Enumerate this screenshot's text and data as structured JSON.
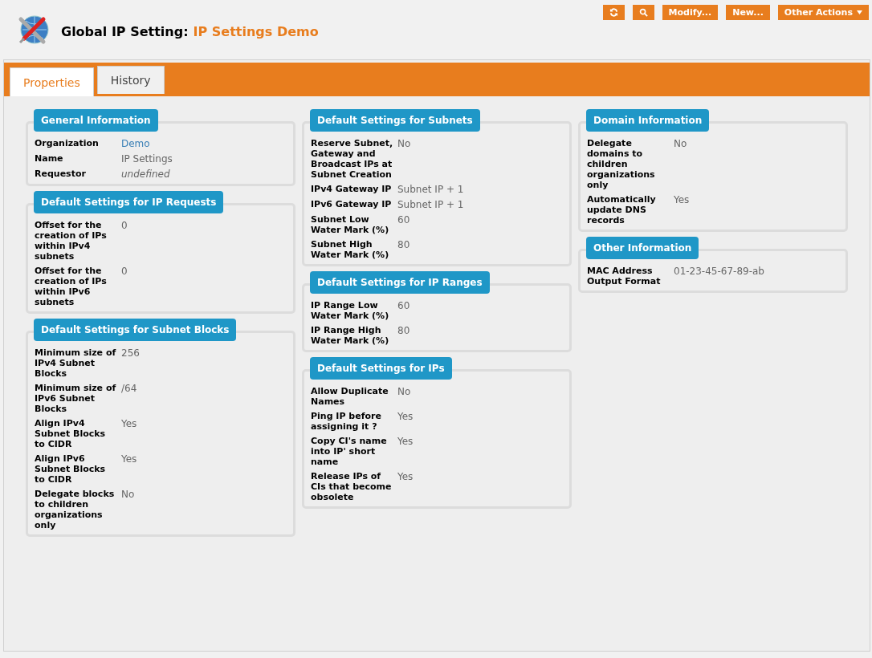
{
  "header": {
    "title": "Global IP Setting:",
    "subtitle": "IP Settings Demo"
  },
  "actions": [
    {
      "kind": "refresh"
    },
    {
      "kind": "search"
    },
    {
      "kind": "text",
      "label": "Modify..."
    },
    {
      "kind": "text",
      "label": "New..."
    },
    {
      "kind": "menu",
      "label": "Other Actions"
    }
  ],
  "tabs": [
    {
      "label": "Properties",
      "selected": true
    },
    {
      "label": "History",
      "selected": false
    }
  ],
  "columns": [
    [
      {
        "title": "General Information",
        "rows": [
          {
            "label": "Organization",
            "value": "Demo",
            "kind": "link"
          },
          {
            "label": "Name",
            "value": "IP Settings",
            "kind": "text"
          },
          {
            "label": "Requestor",
            "value": "undefined",
            "kind": "italic"
          }
        ]
      },
      {
        "title": "Default Settings for IP Requests",
        "rows": [
          {
            "label": "Offset for the creation of IPs within IPv4 subnets",
            "value": "0",
            "kind": "text"
          },
          {
            "label": "Offset for the creation of IPs within IPv6 subnets",
            "value": "0",
            "kind": "text"
          }
        ]
      },
      {
        "title": "Default Settings for Subnet Blocks",
        "rows": [
          {
            "label": "Minimum size of IPv4 Subnet Blocks",
            "value": "256",
            "kind": "text"
          },
          {
            "label": "Minimum size of IPv6 Subnet Blocks",
            "value": "/64",
            "kind": "text"
          },
          {
            "label": "Align IPv4 Subnet Blocks to CIDR",
            "value": "Yes",
            "kind": "text"
          },
          {
            "label": "Align IPv6 Subnet Blocks to CIDR",
            "value": "Yes",
            "kind": "text"
          },
          {
            "label": "Delegate blocks to children organizations only",
            "value": "No",
            "kind": "text"
          }
        ]
      }
    ],
    [
      {
        "title": "Default Settings for Subnets",
        "rows": [
          {
            "label": "Reserve Subnet, Gateway and Broadcast IPs at Subnet Creation",
            "value": "No",
            "kind": "text"
          },
          {
            "label": "IPv4 Gateway IP",
            "value": "Subnet IP + 1",
            "kind": "text"
          },
          {
            "label": "IPv6 Gateway IP",
            "value": "Subnet IP + 1",
            "kind": "text"
          },
          {
            "label": "Subnet Low Water Mark (%)",
            "value": "60",
            "kind": "text"
          },
          {
            "label": "Subnet High Water Mark (%)",
            "value": "80",
            "kind": "text"
          }
        ]
      },
      {
        "title": "Default Settings for IP Ranges",
        "rows": [
          {
            "label": "IP Range Low Water Mark (%)",
            "value": "60",
            "kind": "text"
          },
          {
            "label": "IP Range High Water Mark (%)",
            "value": "80",
            "kind": "text"
          }
        ]
      },
      {
        "title": "Default Settings for IPs",
        "rows": [
          {
            "label": "Allow Duplicate Names",
            "value": "No",
            "kind": "text"
          },
          {
            "label": "Ping IP before assigning it ?",
            "value": "Yes",
            "kind": "text"
          },
          {
            "label": "Copy CI's name into IP' short name",
            "value": "Yes",
            "kind": "text"
          },
          {
            "label": "Release IPs of CIs that become obsolete",
            "value": "Yes",
            "kind": "text"
          }
        ]
      }
    ],
    [
      {
        "title": "Domain Information",
        "rows": [
          {
            "label": "Delegate domains to children organizations only",
            "value": "No",
            "kind": "text"
          },
          {
            "label": "Automatically update DNS records",
            "value": "Yes",
            "kind": "text"
          }
        ]
      },
      {
        "title": "Other Information",
        "rows": [
          {
            "label": "MAC Address Output Format",
            "value": "01-23-45-67-89-ab",
            "kind": "text"
          }
        ]
      }
    ]
  ]
}
